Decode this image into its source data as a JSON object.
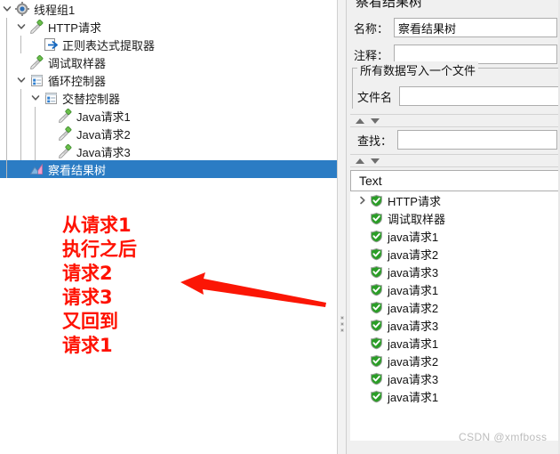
{
  "tree": {
    "rows": [
      {
        "label": "线程组1",
        "indent": 0,
        "twisty": "expanded",
        "icon": "gear-icon",
        "selected": false
      },
      {
        "label": "HTTP请求",
        "indent": 1,
        "twisty": "expanded",
        "icon": "sampler-icon",
        "selected": false
      },
      {
        "label": "正则表达式提取器",
        "indent": 2,
        "twisty": "none",
        "icon": "extractor-icon",
        "selected": false
      },
      {
        "label": "调试取样器",
        "indent": 1,
        "twisty": "none",
        "icon": "sampler-icon",
        "selected": false
      },
      {
        "label": "循环控制器",
        "indent": 1,
        "twisty": "expanded",
        "icon": "controller-icon",
        "selected": false
      },
      {
        "label": "交替控制器",
        "indent": 2,
        "twisty": "expanded",
        "icon": "controller-icon",
        "selected": false
      },
      {
        "label": "Java请求1",
        "indent": 3,
        "twisty": "none",
        "icon": "sampler-icon",
        "selected": false
      },
      {
        "label": "Java请求2",
        "indent": 3,
        "twisty": "none",
        "icon": "sampler-icon",
        "selected": false
      },
      {
        "label": "Java请求3",
        "indent": 3,
        "twisty": "none",
        "icon": "sampler-icon",
        "selected": false
      },
      {
        "label": "察看结果树",
        "indent": 1,
        "twisty": "none",
        "icon": "results-tree-icon",
        "selected": true
      }
    ]
  },
  "annotation": {
    "color": "#ff1100",
    "lines": [
      "从请求1",
      "执行之后",
      "请求2",
      "请求3",
      "又回到",
      "请求1"
    ],
    "arrow_color": "#fb1605",
    "arrow_name": "red-arrow"
  },
  "splitter": {
    "name": "panel-splitter"
  },
  "right_panel": {
    "title": "察看结果树",
    "name_label": "名称：",
    "name_value": "察看结果树",
    "comment_label": "注释：",
    "comment_value": "",
    "group_legend": "所有数据写入一个文件",
    "filename_label": "文件名",
    "filename_value": "",
    "search_label": "查找：",
    "search_value": "",
    "renderer_value": "Text",
    "spinner_up": "▲",
    "spinner_down": "▼"
  },
  "results": {
    "rows": [
      {
        "label": "HTTP请求",
        "status": "success",
        "twisty": "collapsed"
      },
      {
        "label": "调试取样器",
        "status": "success",
        "twisty": "none"
      },
      {
        "label": "java请求1",
        "status": "success",
        "twisty": "none"
      },
      {
        "label": "java请求2",
        "status": "success",
        "twisty": "none"
      },
      {
        "label": "java请求3",
        "status": "success",
        "twisty": "none"
      },
      {
        "label": "java请求1",
        "status": "success",
        "twisty": "none"
      },
      {
        "label": "java请求2",
        "status": "success",
        "twisty": "none"
      },
      {
        "label": "java请求3",
        "status": "success",
        "twisty": "none"
      },
      {
        "label": "java请求1",
        "status": "success",
        "twisty": "none"
      },
      {
        "label": "java请求2",
        "status": "success",
        "twisty": "none"
      },
      {
        "label": "java请求3",
        "status": "success",
        "twisty": "none"
      },
      {
        "label": "java请求1",
        "status": "success",
        "twisty": "none"
      }
    ]
  },
  "watermark": {
    "text": "CSDN @xmfboss"
  },
  "colors": {
    "selection_blue": "#2b7cc4",
    "annotation_red": "#ff1100",
    "shield_green": "#2a9d26",
    "panel_gray": "#f0f0f0"
  }
}
